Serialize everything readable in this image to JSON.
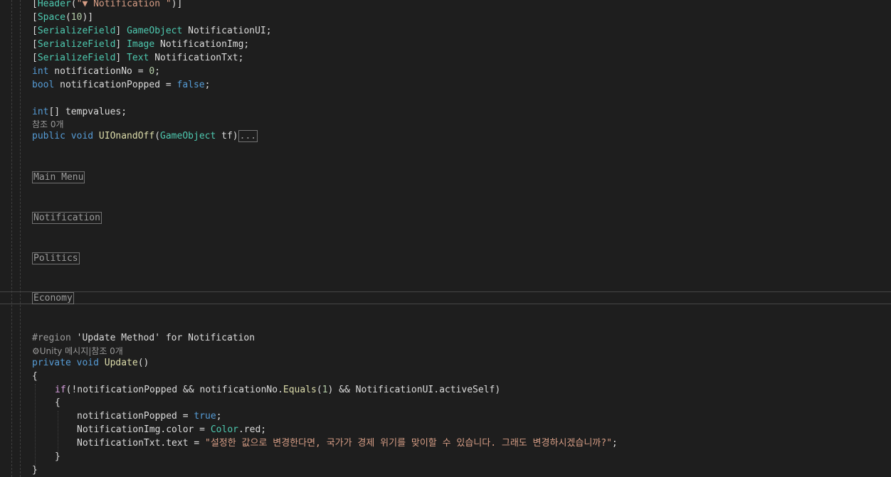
{
  "header_attr": {
    "open": "[",
    "name": "Header",
    "args_open": "(",
    "arg": "\"▼ Notification \"",
    "close": ")]"
  },
  "space_attr": {
    "open": "[",
    "name": "Space",
    "args_open": "(",
    "arg": "10",
    "close": ")]"
  },
  "fields": [
    {
      "attr": "SerializeField",
      "type": "GameObject",
      "name": "NotificationUI;"
    },
    {
      "attr": "SerializeField",
      "type": "Image",
      "name": "NotificationImg;"
    },
    {
      "attr": "SerializeField",
      "type": "Text",
      "name": "NotificationTxt;"
    }
  ],
  "int_field": {
    "kw": "int",
    "rest": " notificationNo = ",
    "val": "0",
    "end": ";"
  },
  "bool_field": {
    "kw": "bool",
    "rest": " notificationPopped = ",
    "val": "false",
    "end": ";"
  },
  "int_arr": {
    "kw": "int",
    "rest": "[] tempvalues;"
  },
  "ref_lens_1": "참조 0개",
  "method1": {
    "mods": "public void ",
    "name": "UIOnandOff",
    "open": "(",
    "ptype": "GameObject",
    "pname": " tf)",
    "fold": "..."
  },
  "regions": [
    "Main Menu",
    "Notification",
    "Politics",
    "Economy"
  ],
  "region_line": {
    "kw": "#region",
    "text": " 'Update Method' for Notification"
  },
  "unity_lens": {
    "icon": "⚙",
    "text": "Unity 메시지|참조 0개"
  },
  "method2": {
    "mods": "private void ",
    "name": "Update",
    "parens": "()"
  },
  "open_brace": "{",
  "if_line": {
    "kw": "if",
    "p1": "(!notificationPopped && notificationNo.",
    "fn": "Equals",
    "p2": "(",
    "num": "1",
    "p3": ") && NotificationUI.activeSelf)"
  },
  "inner_open": "{",
  "assign1": {
    "lhs": "notificationPopped = ",
    "val": "true",
    "end": ";"
  },
  "assign2": {
    "lhs": "NotificationImg.color = ",
    "type": "Color",
    "rest": ".red;"
  },
  "assign3": {
    "lhs": "NotificationTxt.text = ",
    "str": "\"설정한 값으로 변경한다면, 국가가 경제 위기를 맞이할 수 있습니다. 그래도 변경하시겠습니까?\"",
    "end": ";"
  },
  "inner_close": "}",
  "close_brace": "}"
}
